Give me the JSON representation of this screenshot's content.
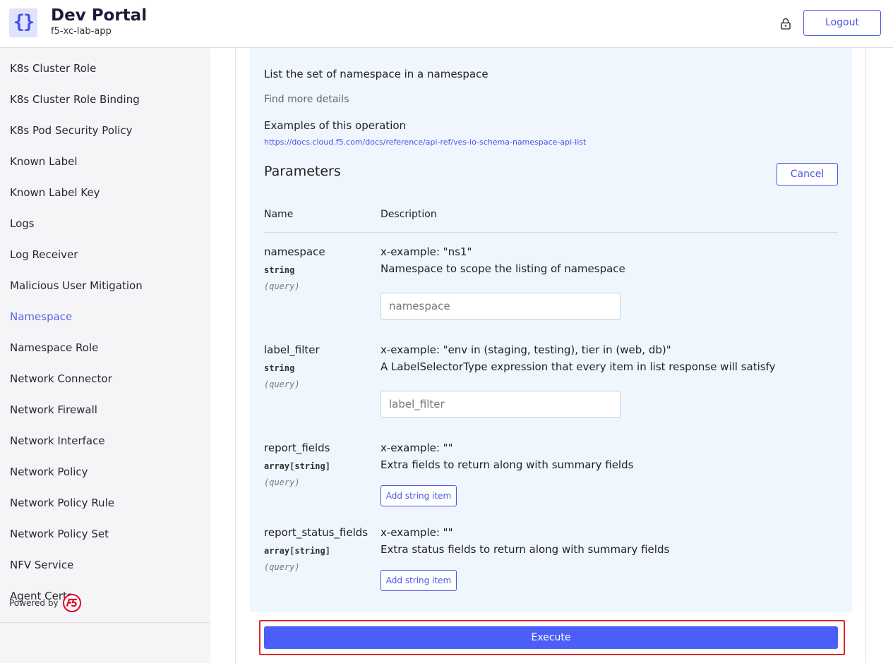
{
  "header": {
    "logo_glyph": "{}",
    "title": "Dev Portal",
    "subtitle": "f5-xc-lab-app",
    "lock_icon": "lock-icon",
    "logout_label": "Logout"
  },
  "sidebar": {
    "items": [
      {
        "label": "K8s Cluster Role"
      },
      {
        "label": "K8s Cluster Role Binding"
      },
      {
        "label": "K8s Pod Security Policy"
      },
      {
        "label": "Known Label"
      },
      {
        "label": "Known Label Key"
      },
      {
        "label": "Logs"
      },
      {
        "label": "Log Receiver"
      },
      {
        "label": "Malicious User Mitigation"
      },
      {
        "label": "Namespace",
        "active": true
      },
      {
        "label": "Namespace Role"
      },
      {
        "label": "Network Connector"
      },
      {
        "label": "Network Firewall"
      },
      {
        "label": "Network Interface"
      },
      {
        "label": "Network Policy"
      },
      {
        "label": "Network Policy Rule"
      },
      {
        "label": "Network Policy Set"
      },
      {
        "label": "NFV Service"
      },
      {
        "label": "Agent Certs"
      }
    ],
    "powered_by": "Powered by",
    "brand_icon": "f5-logo-icon"
  },
  "operation": {
    "summary": "List the set of namespace in a namespace",
    "find_more": "Find more details",
    "examples_title": "Examples of this operation",
    "examples_link": "https://docs.cloud.f5.com/docs/reference/api-ref/ves-io-schema-namespace-api-list"
  },
  "parameters": {
    "title": "Parameters",
    "cancel_label": "Cancel",
    "col_name": "Name",
    "col_description": "Description",
    "rows": [
      {
        "name": "namespace",
        "type": "string",
        "location": "(query)",
        "example": "x-example: \"ns1\"",
        "description": "Namespace to scope the listing of namespace",
        "placeholder": "namespace",
        "value": ""
      },
      {
        "name": "label_filter",
        "type": "string",
        "location": "(query)",
        "example": "x-example: \"env in (staging, testing), tier in (web, db)\"",
        "description": "A LabelSelectorType expression that every item in list response will satisfy",
        "placeholder": "label_filter",
        "value": ""
      },
      {
        "name": "report_fields",
        "type": "array[string]",
        "location": "(query)",
        "example": "x-example: \"\"",
        "description": "Extra fields to return along with summary fields",
        "add_label": "Add string item"
      },
      {
        "name": "report_status_fields",
        "type": "array[string]",
        "location": "(query)",
        "example": "x-example: \"\"",
        "description": "Extra status fields to return along with summary fields",
        "add_label": "Add string item"
      }
    ]
  },
  "execute_label": "Execute",
  "colors": {
    "accent": "#4a57e6",
    "execute": "#4b5ff8",
    "highlight": "#e0262d",
    "panel_bg": "#f0f6fd",
    "sidebar_bg": "#f5f5f7"
  }
}
